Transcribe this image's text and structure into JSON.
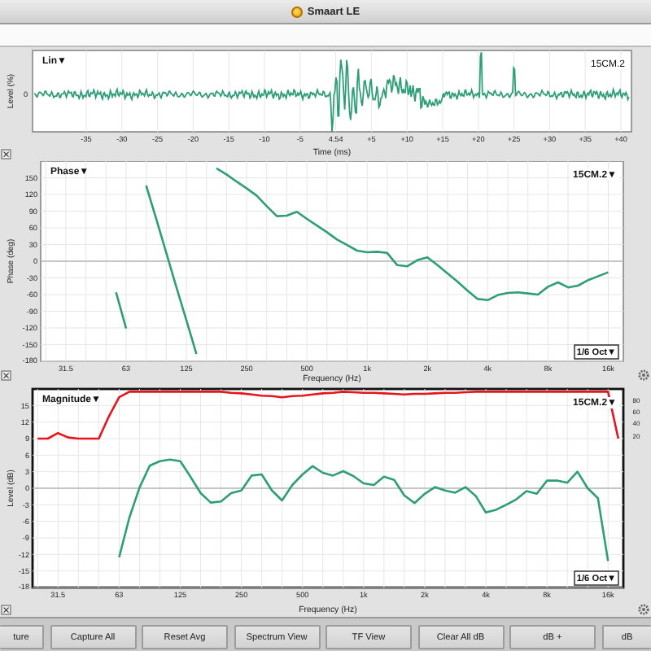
{
  "window": {
    "title": "Smaart LE"
  },
  "impulse": {
    "mode": "Lin▼",
    "measurement": "15CM.2",
    "ylabel": "Level (%)",
    "yticks": [
      "0"
    ],
    "xlabel": "Time (ms)",
    "xticks": [
      "-35",
      "-30",
      "-25",
      "-20",
      "-15",
      "-10",
      "-5",
      "4.54",
      "+5",
      "+10",
      "+15",
      "+20",
      "+25",
      "+30",
      "+35",
      "+40"
    ]
  },
  "phase": {
    "mode": "Phase▼",
    "measurement": "15CM.2▼",
    "smoothing": "1/6 Oct▼",
    "chart_data": {
      "type": "line",
      "grid": true,
      "xlabel": "Frequency (Hz)",
      "ylabel": "Phase (deg)",
      "ylim": [
        -180,
        180
      ],
      "categories": [
        null,
        null,
        "31.5",
        null,
        null,
        null,
        null,
        null,
        "63",
        null,
        null,
        null,
        null,
        null,
        "125",
        null,
        null,
        null,
        null,
        null,
        "250",
        null,
        null,
        null,
        null,
        null,
        "500",
        null,
        null,
        null,
        null,
        null,
        "1k",
        null,
        null,
        null,
        null,
        null,
        "2k",
        null,
        null,
        null,
        null,
        null,
        "4k",
        null,
        null,
        null,
        null,
        null,
        "8k",
        null,
        null,
        null,
        null,
        null,
        "16k",
        null
      ],
      "yticks": [
        150,
        120,
        90,
        60,
        30,
        0,
        -30,
        -60,
        -90,
        -120,
        -150,
        -180
      ],
      "series": [
        {
          "color": "#2e9e78",
          "values": [
            null,
            null,
            null,
            null,
            null,
            null,
            null,
            -56,
            -121,
            null,
            136,
            76,
            15,
            -46,
            -106,
            -167,
            null,
            167,
            156,
            143,
            131,
            118,
            99,
            81,
            82,
            89,
            76,
            64,
            52,
            39,
            29,
            19,
            16,
            17,
            15,
            -7,
            -9,
            2,
            7,
            -7,
            -22,
            -37,
            -53,
            -68,
            -70,
            -61,
            -57,
            -56,
            -58,
            -60,
            -46,
            -38,
            -47,
            -44,
            -34,
            -27,
            -20,
            null
          ]
        }
      ]
    }
  },
  "magnitude": {
    "mode": "Magnitude▼",
    "measurement": "15CM.2▼",
    "smoothing": "1/6 Oct▼",
    "right_ticks": [
      "80",
      "60",
      "40",
      "20"
    ],
    "chart_data": {
      "type": "line",
      "grid": true,
      "xlabel": "Frequency (Hz)",
      "ylabel": "Level (dB)",
      "ylim": [
        -18,
        18
      ],
      "categories": [
        null,
        null,
        "31.5",
        null,
        null,
        null,
        null,
        null,
        "63",
        null,
        null,
        null,
        null,
        null,
        "125",
        null,
        null,
        null,
        null,
        null,
        "250",
        null,
        null,
        null,
        null,
        null,
        "500",
        null,
        null,
        null,
        null,
        null,
        "1k",
        null,
        null,
        null,
        null,
        null,
        "2k",
        null,
        null,
        null,
        null,
        null,
        "4k",
        null,
        null,
        null,
        null,
        null,
        "8k",
        null,
        null,
        null,
        null,
        null,
        "16k",
        null
      ],
      "yticks": [
        15,
        12,
        9,
        6,
        3,
        0,
        -3,
        -6,
        -9,
        -12,
        -15,
        -18
      ],
      "series": [
        {
          "color": "#e8141c",
          "values": [
            9,
            9,
            10,
            9.2,
            9,
            9,
            9,
            13,
            16.5,
            17.5,
            17.5,
            17.5,
            17.5,
            17.5,
            17.5,
            17.5,
            17.5,
            17.5,
            17.5,
            17.3,
            17.2,
            17,
            16.8,
            16.7,
            16.5,
            16.7,
            16.8,
            17,
            17.2,
            17.3,
            17.5,
            17.4,
            17.3,
            17.3,
            17.2,
            17.1,
            17,
            17.1,
            17.1,
            17.2,
            17.3,
            17.3,
            17.4,
            17.5,
            17.5,
            17.5,
            17.5,
            17.5,
            17.5,
            17.5,
            17.5,
            17.5,
            17.5,
            17.5,
            17.5,
            17.5,
            17.5,
            9
          ]
        },
        {
          "color": "#2e9e78",
          "values": [
            null,
            null,
            null,
            null,
            null,
            null,
            null,
            null,
            -12.5,
            -5.3,
            0.1,
            4.1,
            4.9,
            5.2,
            4.9,
            2.1,
            -0.9,
            -2.6,
            -2.4,
            -0.9,
            -0.4,
            2.3,
            2.5,
            -0.4,
            -2.2,
            0.6,
            2.5,
            4,
            2.8,
            2.3,
            3.1,
            2.2,
            0.9,
            0.6,
            2.1,
            1.5,
            -1.3,
            -2.7,
            -1,
            0.2,
            -0.4,
            -0.8,
            0.2,
            -1.4,
            -4.4,
            -3.9,
            -3,
            -2,
            -0.5,
            -1,
            1.4,
            1.4,
            1,
            3,
            0,
            -1.8,
            -13.2,
            null
          ]
        }
      ]
    }
  },
  "buttons": [
    "ture",
    "Capture All",
    "Reset Avg",
    "Spectrum View",
    "TF View",
    "Clear All dB",
    "dB +",
    "dB"
  ]
}
